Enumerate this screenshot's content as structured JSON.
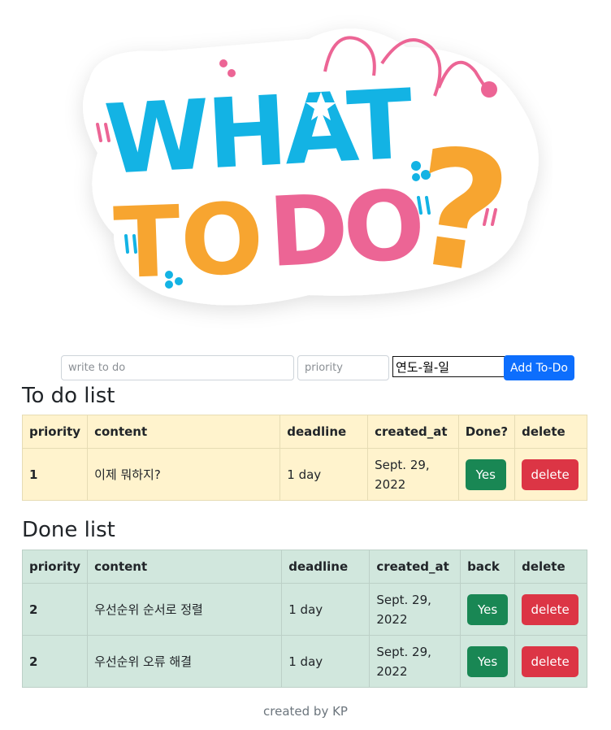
{
  "logo": {
    "line1": "WHAT",
    "line2": "TO DO",
    "mark": "?",
    "colors": {
      "blue": "#13b3e4",
      "orange": "#f7a530",
      "pink": "#ec6595"
    }
  },
  "form": {
    "todo_placeholder": "write to do",
    "priority_placeholder": "priority",
    "date_value": "연도-월-일",
    "add_label": "Add To-Do"
  },
  "todo": {
    "heading": "To do list",
    "headers": [
      "priority",
      "content",
      "deadline",
      "created_at",
      "Done?",
      "delete"
    ],
    "rows": [
      {
        "priority": "1",
        "content": "이제 뭐하지?",
        "deadline": "1 day",
        "created_line1": "Sept. 29,",
        "created_line2": "2022",
        "action": "Yes",
        "delete": "delete"
      }
    ]
  },
  "done": {
    "heading": "Done list",
    "headers": [
      "priority",
      "content",
      "deadline",
      "created_at",
      "back",
      "delete"
    ],
    "rows": [
      {
        "priority": "2",
        "content": "우선순위 순서로 정렬",
        "deadline": "1 day",
        "created_line1": "Sept. 29,",
        "created_line2": "2022",
        "action": "Yes",
        "delete": "delete"
      },
      {
        "priority": "2",
        "content": "우선순위 오류 해결",
        "deadline": "1 day",
        "created_line1": "Sept. 29,",
        "created_line2": "2022",
        "action": "Yes",
        "delete": "delete"
      }
    ]
  },
  "footer": "created by KP"
}
